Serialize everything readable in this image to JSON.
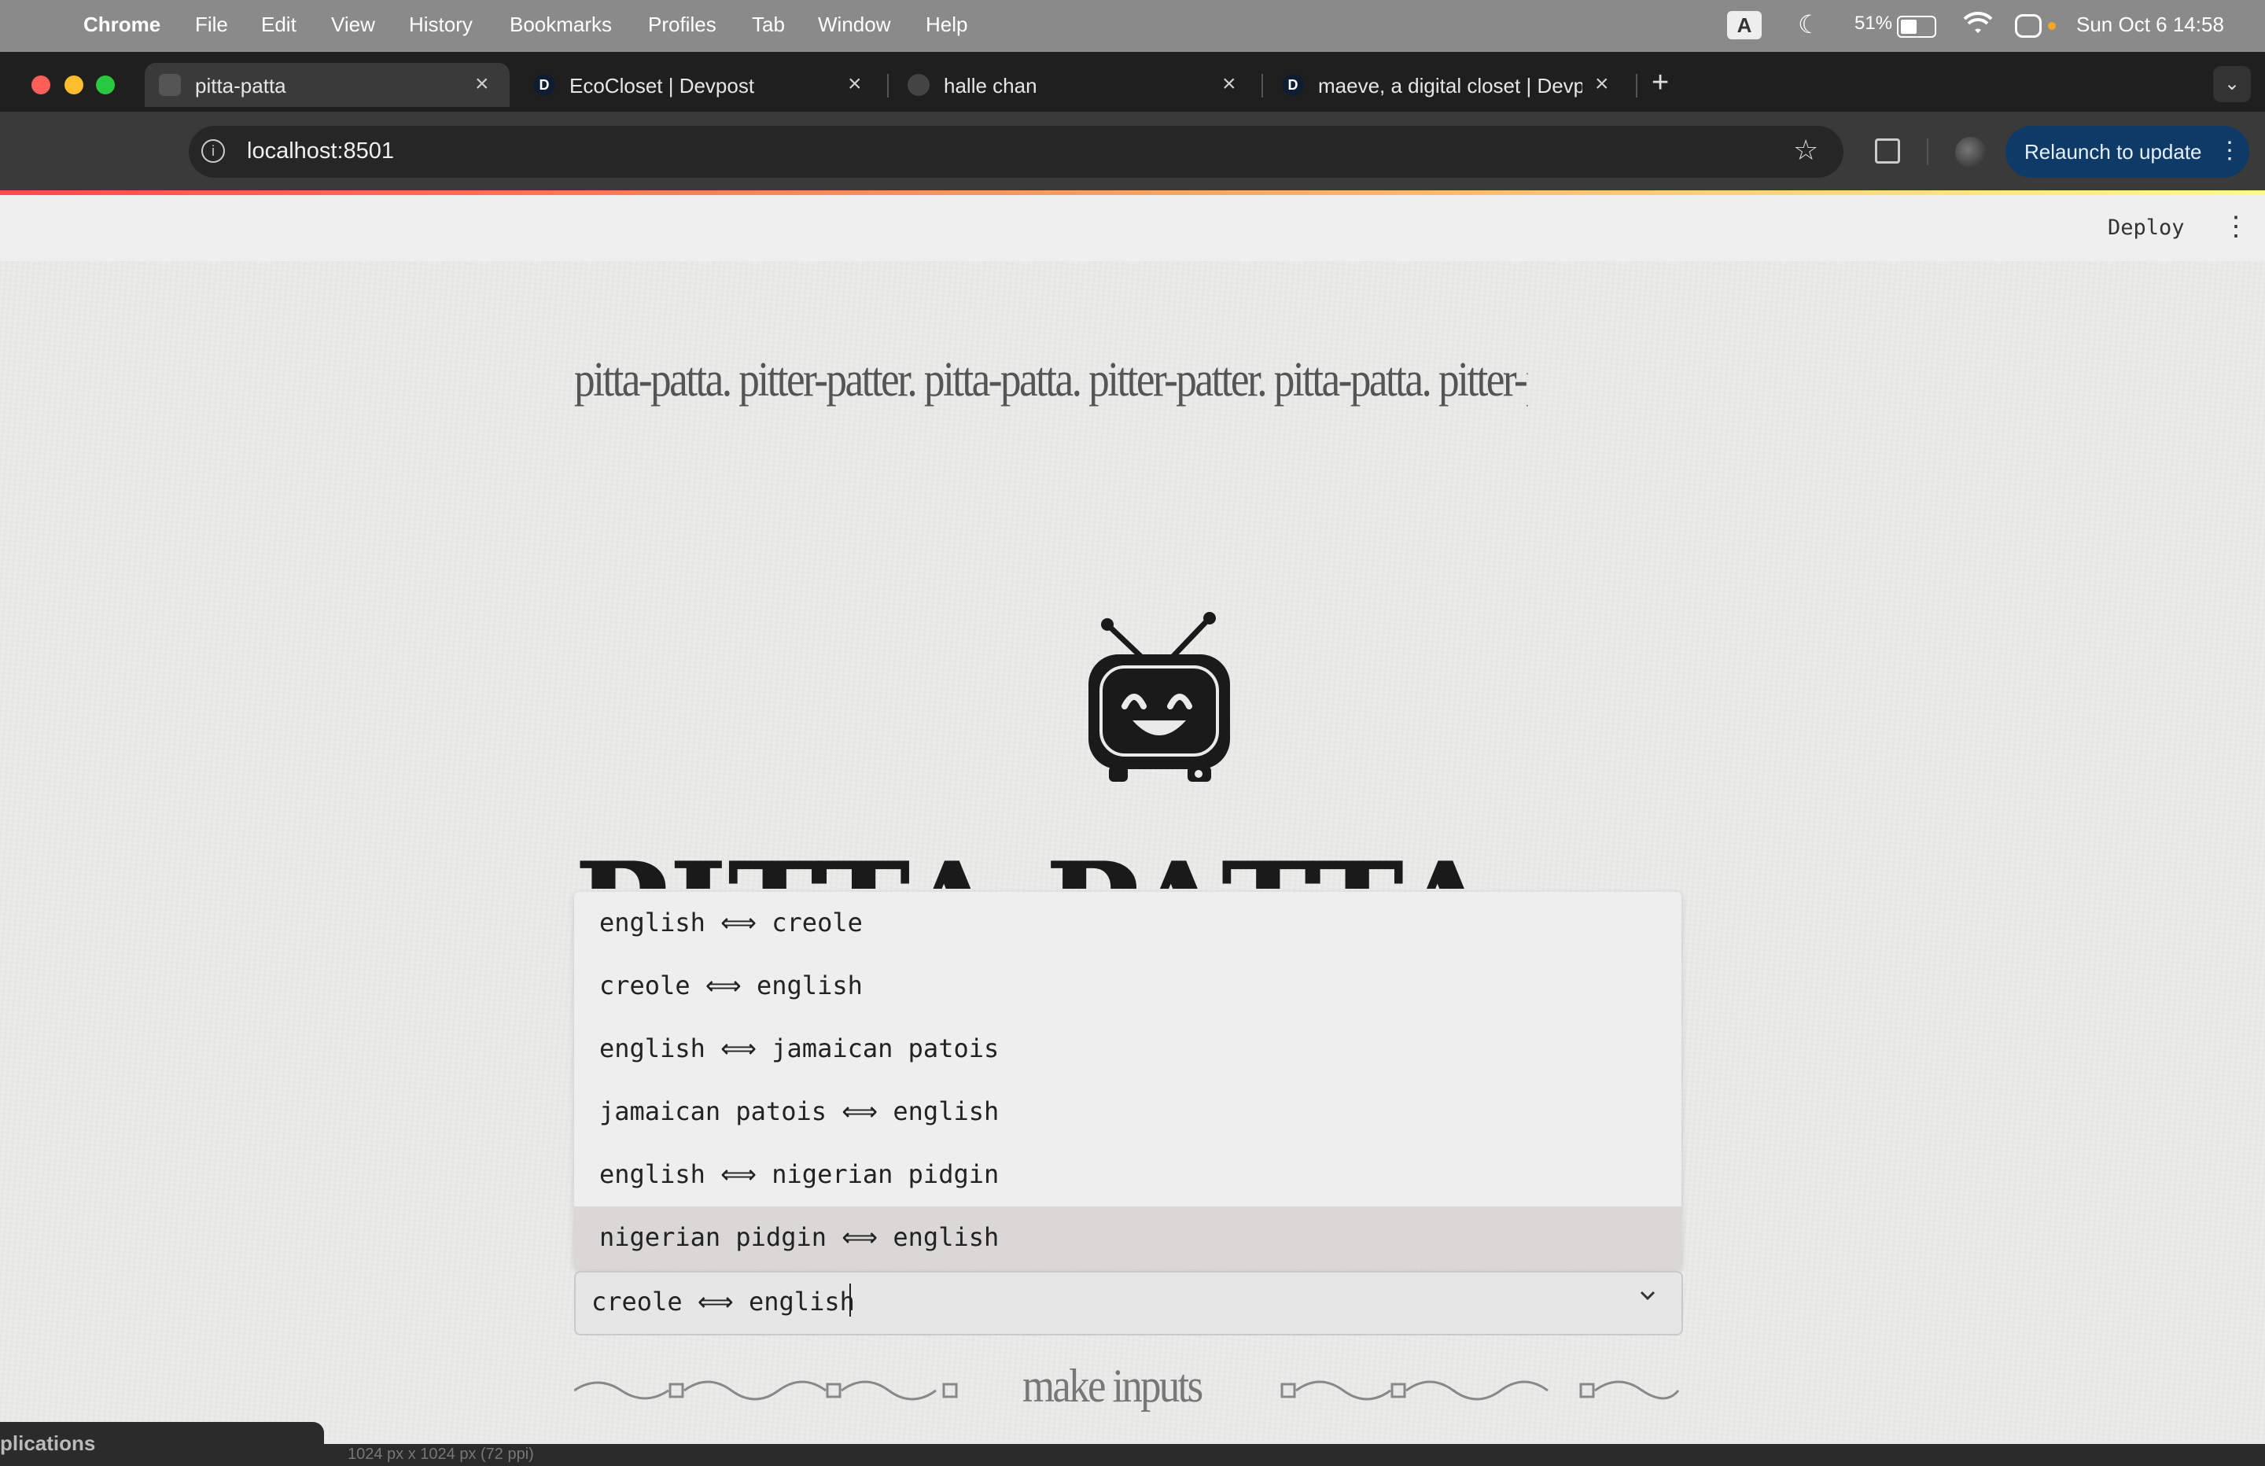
{
  "menubar": {
    "app_name": "Chrome",
    "items": [
      "File",
      "Edit",
      "View",
      "History",
      "Bookmarks",
      "Profiles",
      "Tab",
      "Window",
      "Help"
    ],
    "input_source": "A",
    "battery": "51%",
    "datetime": "Sun Oct 6  14:58"
  },
  "tabs": [
    {
      "title": "pitta-patta",
      "favicon": "",
      "active": true
    },
    {
      "title": "EcoCloset | Devpost",
      "favicon": "D",
      "active": false
    },
    {
      "title": "halle chan",
      "favicon": "",
      "active": false
    },
    {
      "title": "maeve, a digital closet | Devpost",
      "favicon": "D",
      "active": false
    }
  ],
  "toolbar": {
    "url": "localhost:8501",
    "relaunch_label": "Relaunch to update"
  },
  "app_header": {
    "deploy_label": "Deploy"
  },
  "content": {
    "marquee": "pitta-patta. pitter-patter. pitta-patta. pitter-patter. pitta-patta. pitter-patt",
    "title_partial": "PITTA PATTA",
    "dropdown_options": [
      "english ⟺ creole",
      "creole ⟺ english",
      "english ⟺ jamaican patois",
      "jamaican patois ⟺ english",
      "english ⟺ nigerian pidgin",
      "nigerian pidgin ⟺ english"
    ],
    "highlighted_option_index": 5,
    "select_value": "creole ⟺ english",
    "section_label": "make inputs"
  },
  "overlay": {
    "panel_label": "plications",
    "bar_text": "1024 px x 1024 px (72 ppi)"
  },
  "colors": {
    "relaunch_bg": "#0d3a66",
    "paper_bg": "#ebebea",
    "highlight": "#d9d8d6"
  }
}
